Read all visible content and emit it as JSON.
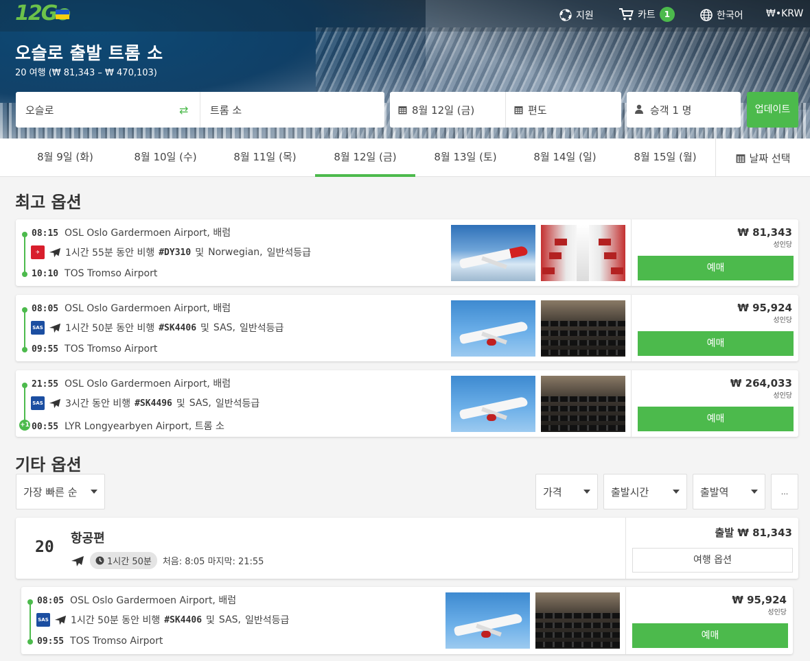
{
  "header": {
    "logo_text": "12Go",
    "nav": {
      "support": "지원",
      "cart": "카트",
      "cart_count": "1",
      "language": "한국어",
      "currency": "₩•KRW"
    },
    "title": "오슬로 출발 트롬 소",
    "subtitle": "20 여행 (₩ 81,343 – ₩ 470,103)"
  },
  "search": {
    "from": "오슬로",
    "to": "트롬 소",
    "date": "8월 12일 (금)",
    "return": "편도",
    "passengers": "승객 1 명",
    "update": "업데이트"
  },
  "date_tabs": [
    {
      "label": "8월 9일 (화)"
    },
    {
      "label": "8월 10일 (수)"
    },
    {
      "label": "8월 11일 (목)"
    },
    {
      "label": "8월 12일 (금)"
    },
    {
      "label": "8월 13일 (토)"
    },
    {
      "label": "8월 14일 (일)"
    },
    {
      "label": "8월 15일 (월)"
    }
  ],
  "date_pick": "날짜 선택",
  "best": {
    "title": "최고 옵션",
    "items": [
      {
        "dep_time": "08:15",
        "dep_place": "OSL Oslo Gardermoen Airport, 배럼",
        "duration": "1시간 55분 동안 비행",
        "flight": "#DY310",
        "and": "및",
        "airline": "Norwegian,",
        "cls": "일반석등급",
        "arr_time": "10:10",
        "arr_place": "TOS Tromso Airport",
        "price": "₩ 81,343",
        "per": "성인당",
        "book": "예매"
      },
      {
        "dep_time": "08:05",
        "dep_place": "OSL Oslo Gardermoen Airport, 배럼",
        "duration": "1시간 50분 동안 비행",
        "flight": "#SK4406",
        "and": "및",
        "airline": "SAS,",
        "cls": "일반석등급",
        "arr_time": "09:55",
        "arr_place": "TOS Tromso Airport",
        "price": "₩ 95,924",
        "per": "성인당",
        "book": "예매"
      },
      {
        "dep_time": "21:55",
        "dep_place": "OSL Oslo Gardermoen Airport, 배럼",
        "duration": "3시간 동안 비행",
        "flight": "#SK4496",
        "and": "및",
        "airline": "SAS,",
        "cls": "일반석등급",
        "arr_time": "00:55",
        "arr_place": "LYR Longyearbyen Airport, 트롬 소",
        "day_offset": "+1",
        "price": "₩ 264,033",
        "per": "성인당",
        "book": "예매"
      }
    ]
  },
  "other": {
    "title": "기타 옵션",
    "sort": "가장 빠른 순",
    "filters": [
      "가격",
      "출발시간",
      "출발역"
    ],
    "more": "...",
    "summary": {
      "count": "20",
      "title": "항공편",
      "duration": "1시간 50분",
      "range": "처음: 8:05 마지막: 21:55",
      "price": "출발 ₩ 81,343",
      "trip_options": "여행 옵션"
    },
    "item": {
      "dep_time": "08:05",
      "dep_place": "OSL Oslo Gardermoen Airport, 배럼",
      "duration": "1시간 50분 동안 비행",
      "flight": "#SK4406",
      "and": "및",
      "airline": "SAS,",
      "cls": "일반석등급",
      "arr_time": "09:55",
      "arr_place": "TOS Tromso Airport",
      "price": "₩ 95,924",
      "per": "성인당",
      "book": "예매"
    }
  },
  "colors": {
    "accent": "#4cba4c",
    "norwegian": "#d81e2c",
    "sas": "#1b4ea1"
  }
}
